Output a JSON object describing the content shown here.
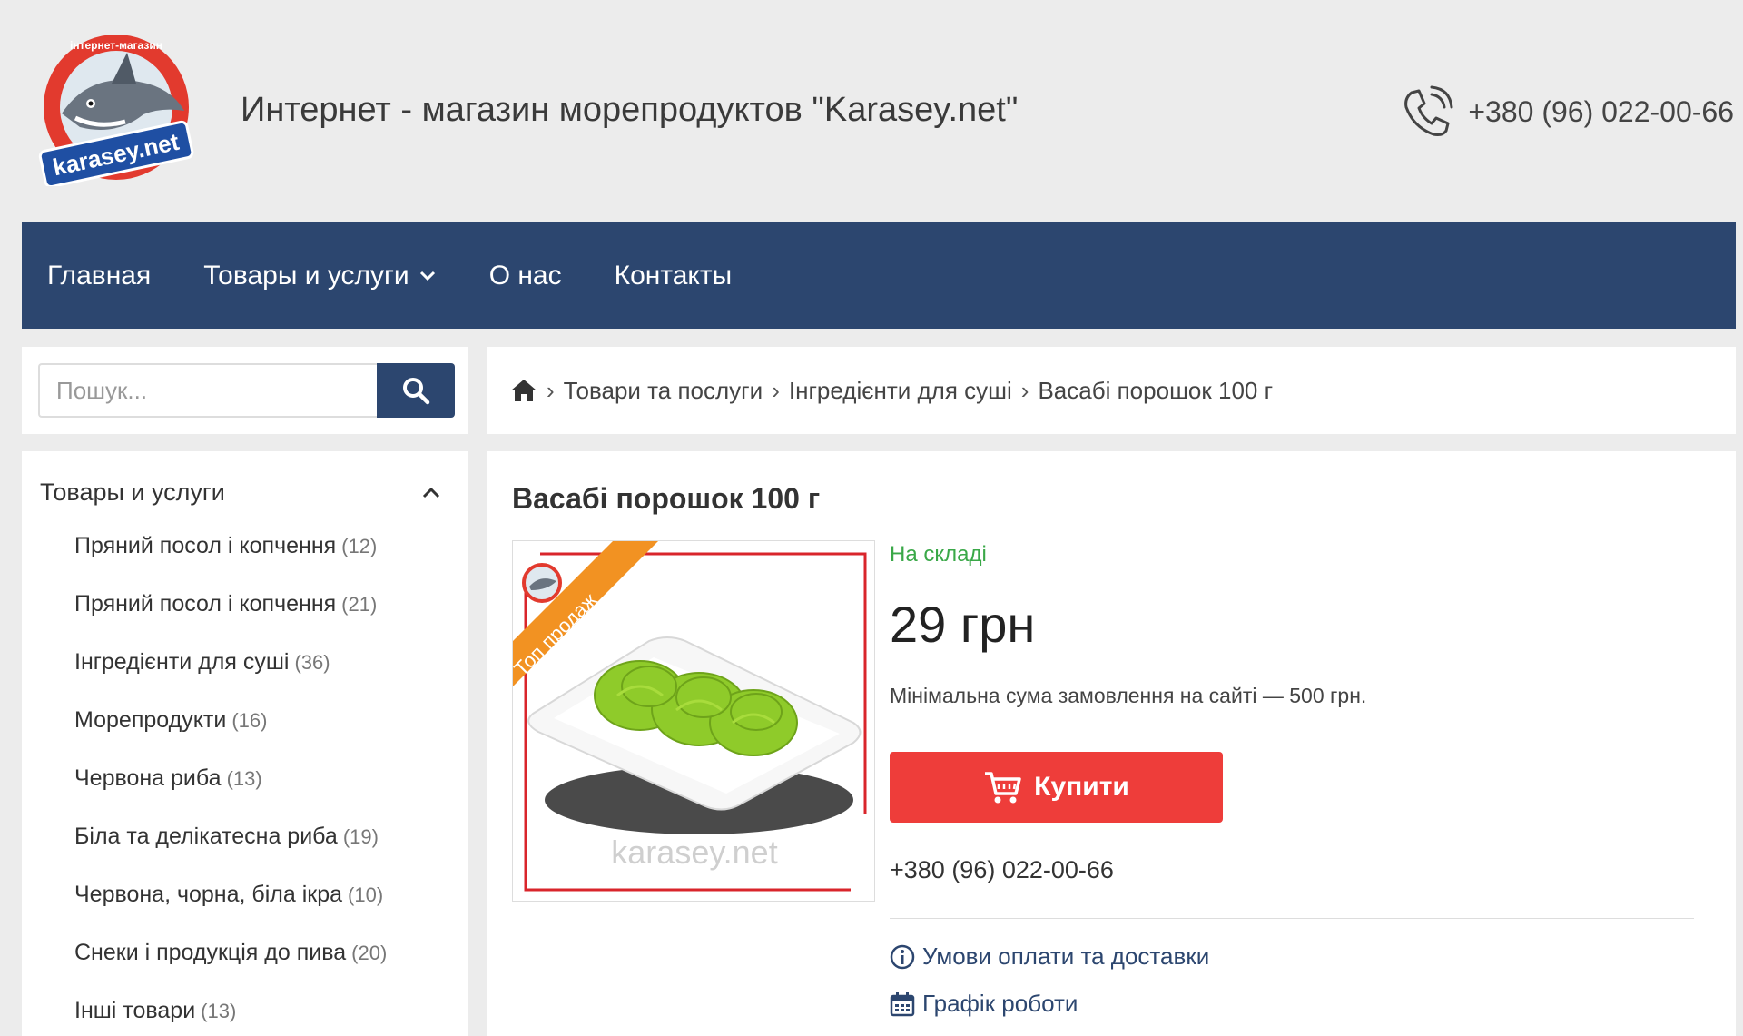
{
  "header": {
    "logo_text": "karasey.net",
    "logo_ring_text": "інтернет-магазин",
    "site_title": "Интернет - магазин морепродуктов \"Karasey.net\"",
    "phone": "+380 (96) 022-00-66"
  },
  "nav": {
    "items": [
      {
        "label": "Главная"
      },
      {
        "label": "Товары и услуги",
        "has_dropdown": true
      },
      {
        "label": "О нас"
      },
      {
        "label": "Контакты"
      }
    ]
  },
  "search": {
    "placeholder": "Пошук...",
    "value": ""
  },
  "sidebar": {
    "title": "Товары и услуги",
    "categories": [
      {
        "label": "Пряний посол і копчення",
        "count": "(12)"
      },
      {
        "label": "Пряний посол і копчення",
        "count": "(21)"
      },
      {
        "label": "Інгредієнти для суші",
        "count": "(36)"
      },
      {
        "label": "Морепродукти",
        "count": "(16)"
      },
      {
        "label": "Червона риба",
        "count": "(13)"
      },
      {
        "label": "Біла та делікатесна риба",
        "count": "(19)"
      },
      {
        "label": "Червона, чорна, біла ікра",
        "count": "(10)"
      },
      {
        "label": "Снеки і продукція до пива",
        "count": "(20)"
      },
      {
        "label": "Інші товари",
        "count": "(13)"
      }
    ]
  },
  "breadcrumb": {
    "items": [
      "Товари та послуги",
      "Інгредієнти для суші",
      "Васабі порошок 100 г"
    ],
    "separator": "›"
  },
  "product": {
    "title": "Васабі порошок 100 г",
    "badge": "Топ продаж",
    "watermark": "karasey.net",
    "stock": "На складі",
    "price": "29 грн",
    "min_order": "Мінімальна сума замовлення на сайті — 500 грн.",
    "buy_label": "Купити",
    "phone": "+380 (96) 022-00-66",
    "links": [
      {
        "label": "Умови оплати та доставки",
        "icon": "info-icon"
      },
      {
        "label": "Графік роботи",
        "icon": "calendar-icon"
      }
    ]
  },
  "colors": {
    "nav_bg": "#2c466f",
    "buy_button": "#ee3d3a",
    "stock_green": "#3aa848",
    "badge_orange": "#f29222",
    "page_bg": "#ececec"
  }
}
